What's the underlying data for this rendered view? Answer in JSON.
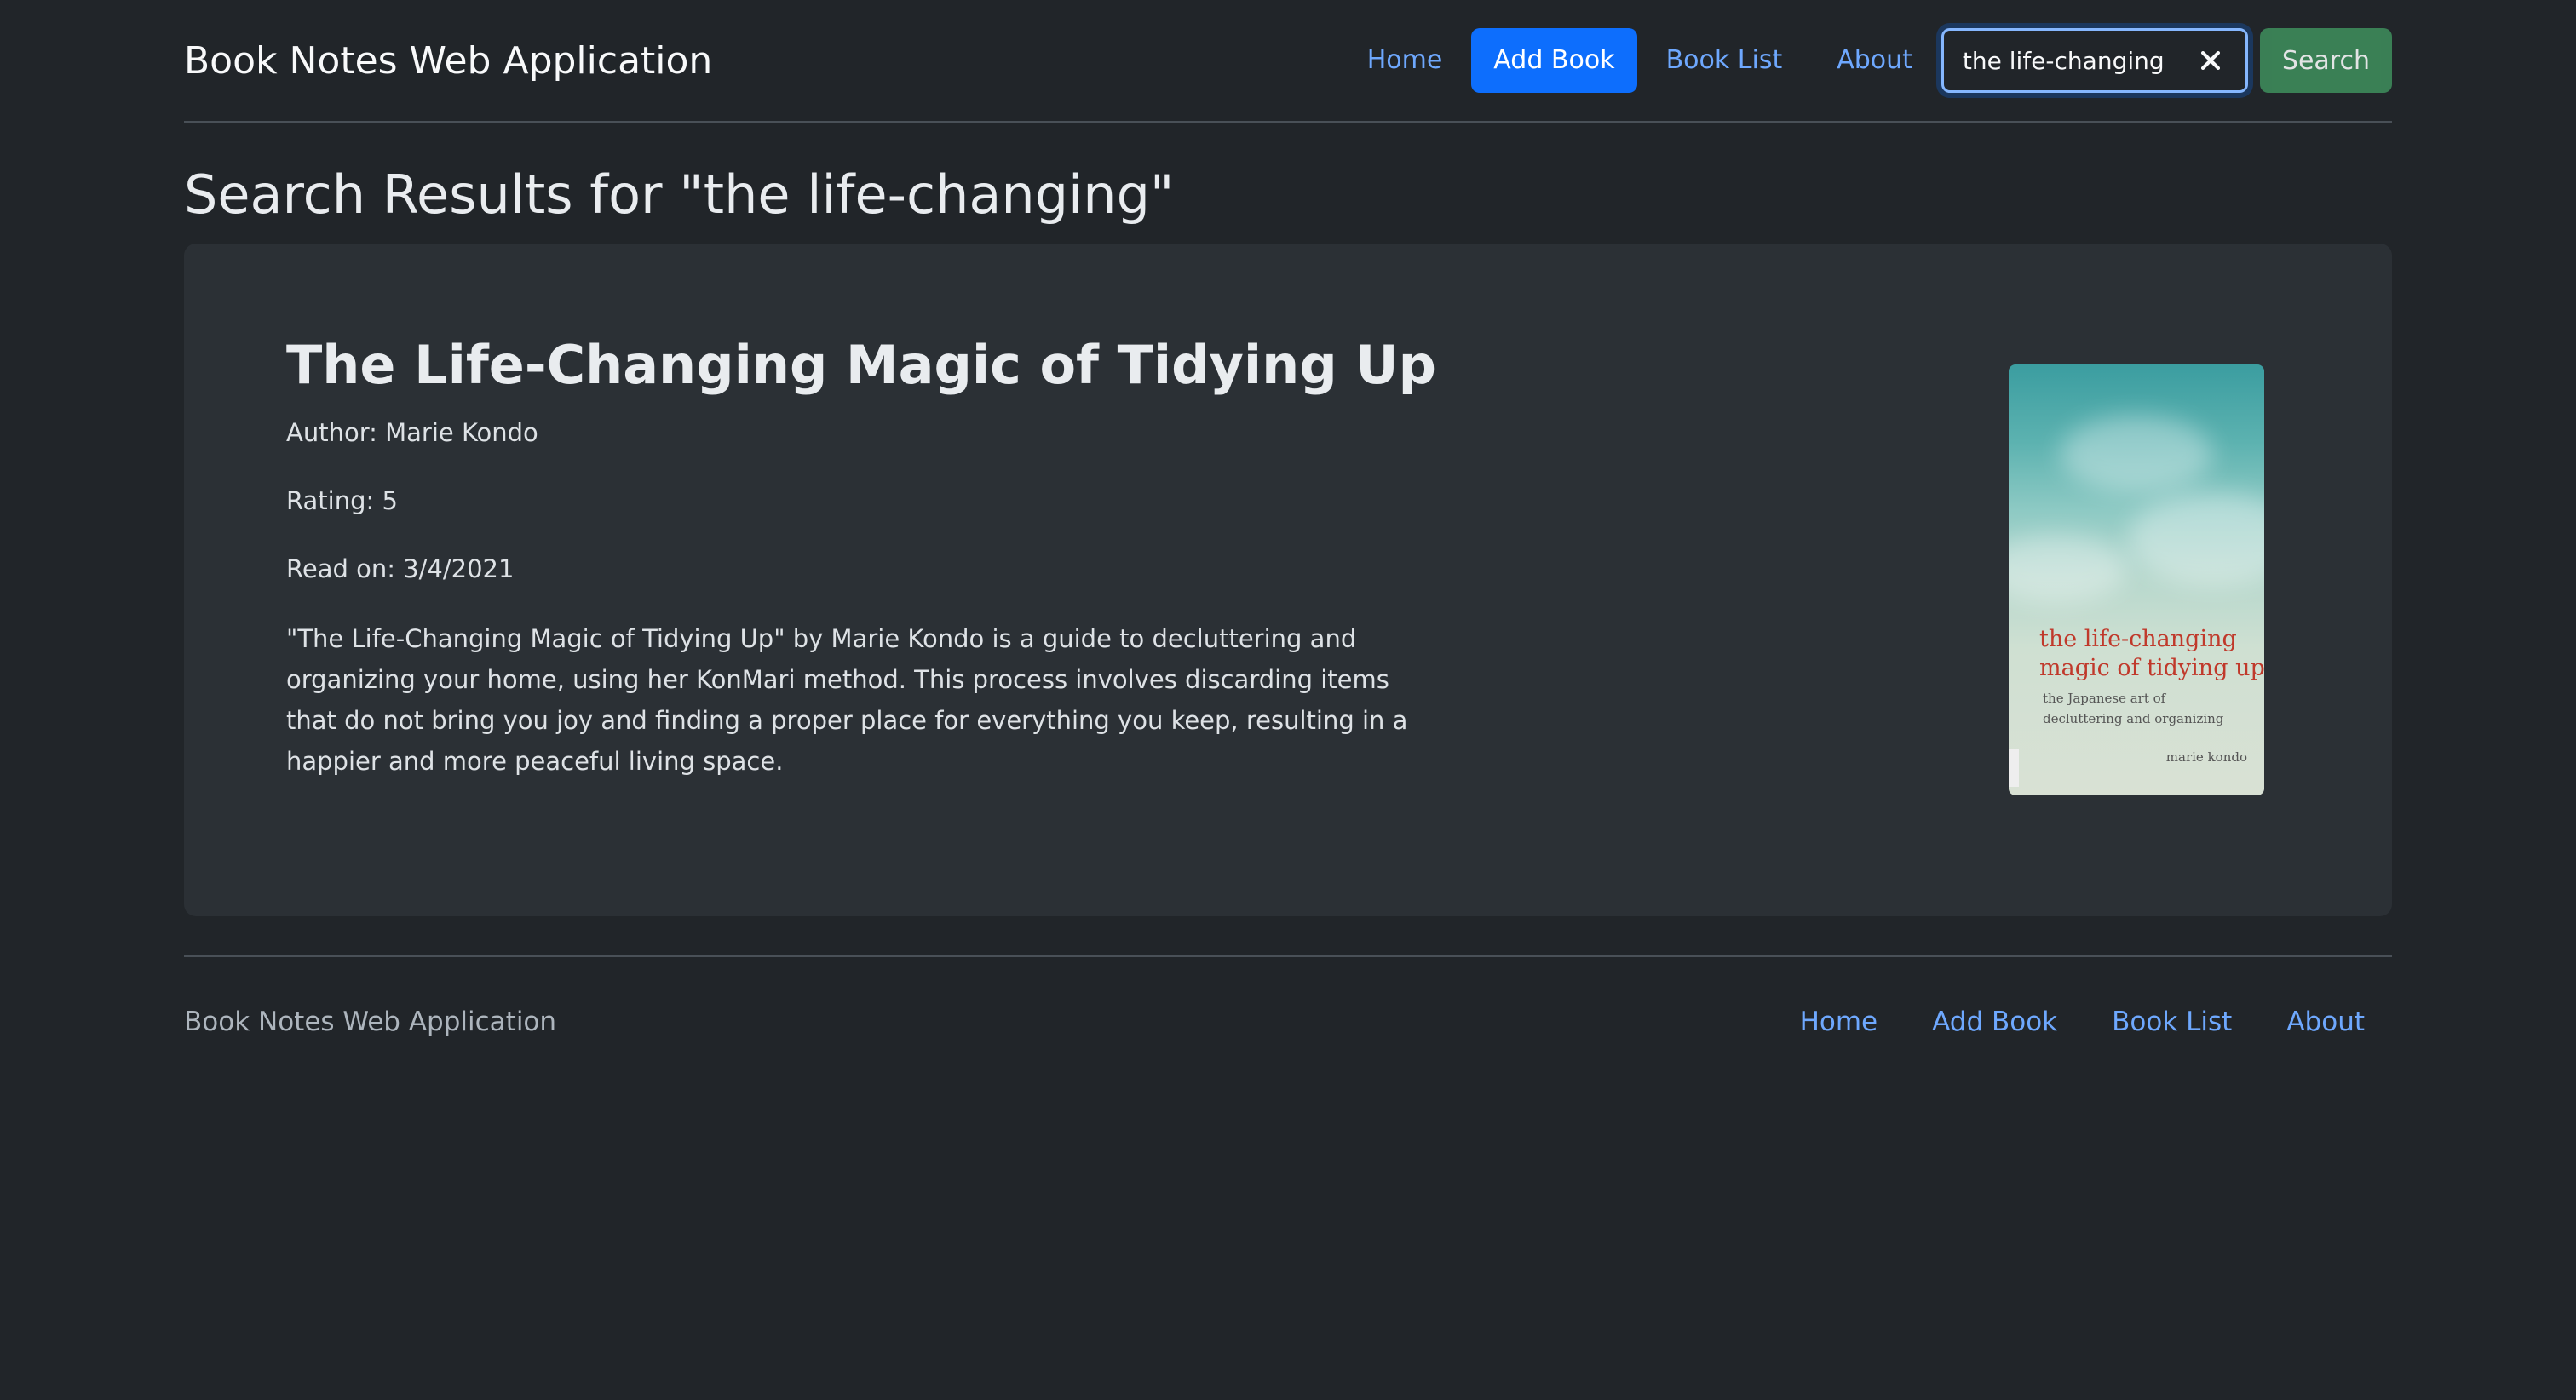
{
  "header": {
    "brand": "Book Notes Web Application",
    "nav": [
      {
        "label": "Home",
        "active": false
      },
      {
        "label": "Add Book",
        "active": true
      },
      {
        "label": "Book List",
        "active": false
      },
      {
        "label": "About",
        "active": false
      }
    ],
    "search": {
      "value": "the life-changing",
      "placeholder": "Search",
      "button_label": "Search",
      "clear_icon": "close-icon"
    }
  },
  "page_title": "Search Results for \"the life-changing\"",
  "result": {
    "title": "The Life-Changing Magic of Tidying Up",
    "author": "Author: Marie Kondo",
    "rating": "Rating: 5",
    "read_on": "Read on: 3/4/2021",
    "description": "\"The Life-Changing Magic of Tidying Up\" by Marie Kondo is a guide to decluttering and organizing your home, using her KonMari method. This process involves discarding items that do not bring you joy and finding a proper place for everything you keep, resulting in a happier and more peaceful living space.",
    "cover": {
      "title_line1": "the life-changing",
      "title_line2": "magic of tidying up",
      "subtitle": "the Japanese art of decluttering and organizing",
      "author": "marie kondo"
    }
  },
  "footer": {
    "brand": "Book Notes Web Application",
    "nav": [
      "Home",
      "Add Book",
      "Book List",
      "About"
    ]
  },
  "colors": {
    "background": "#212529",
    "card": "#2b3035",
    "link": "#6ea8fe",
    "primary": "#0d6efd",
    "success": "#3d8a5a",
    "cover_title": "#c0392b"
  }
}
